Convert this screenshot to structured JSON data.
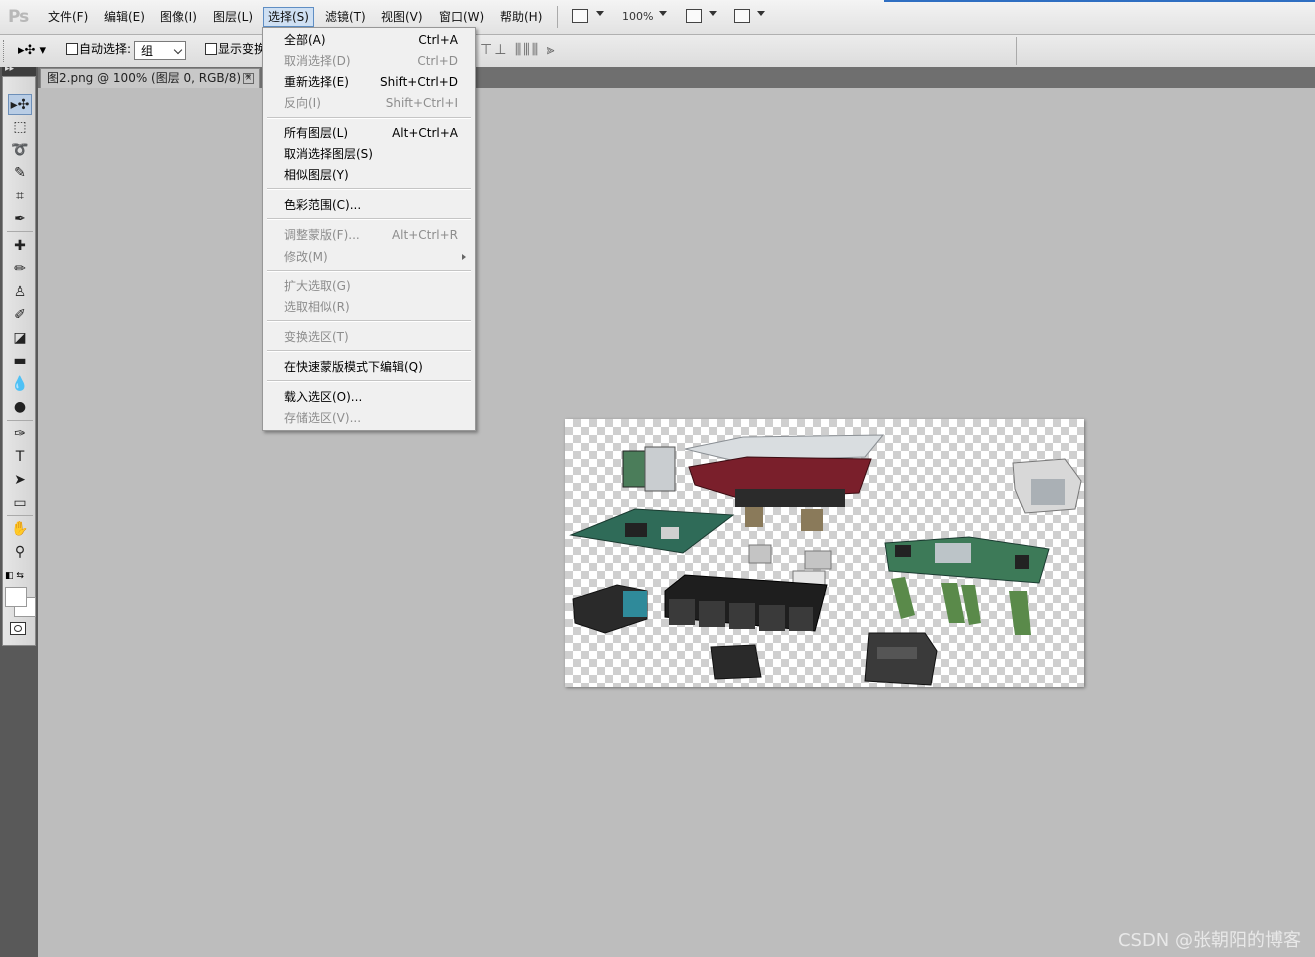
{
  "app": {
    "logo": "Ps"
  },
  "menubar": {
    "items": [
      "文件(F)",
      "编辑(E)",
      "图像(I)",
      "图层(L)",
      "选择(S)",
      "滤镜(T)",
      "视图(V)",
      "窗口(W)",
      "帮助(H)"
    ],
    "active": "选择(S)",
    "zoom": "100%"
  },
  "options": {
    "auto_select_label": "自动选择:",
    "auto_select_value": "组",
    "show_transform_label": "显示变换"
  },
  "document": {
    "tab_title": "图2.png @ 100% (图层 0, RGB/8) *",
    "close": "×"
  },
  "select_menu": {
    "items": [
      {
        "label": "全部(A)",
        "shortcut": "Ctrl+A",
        "enabled": true
      },
      {
        "label": "取消选择(D)",
        "shortcut": "Ctrl+D",
        "enabled": false
      },
      {
        "label": "重新选择(E)",
        "shortcut": "Shift+Ctrl+D",
        "enabled": true
      },
      {
        "label": "反向(I)",
        "shortcut": "Shift+Ctrl+I",
        "enabled": false
      },
      {
        "label": "所有图层(L)",
        "shortcut": "Alt+Ctrl+A",
        "enabled": true
      },
      {
        "label": "取消选择图层(S)",
        "shortcut": "",
        "enabled": true
      },
      {
        "label": "相似图层(Y)",
        "shortcut": "",
        "enabled": true
      },
      {
        "label": "色彩范围(C)...",
        "shortcut": "",
        "enabled": true
      },
      {
        "label": "调整蒙版(F)...",
        "shortcut": "Alt+Ctrl+R",
        "enabled": false
      },
      {
        "label": "修改(M)",
        "shortcut": "",
        "enabled": false,
        "submenu": true
      },
      {
        "label": "扩大选取(G)",
        "shortcut": "",
        "enabled": false
      },
      {
        "label": "选取相似(R)",
        "shortcut": "",
        "enabled": false
      },
      {
        "label": "变换选区(T)",
        "shortcut": "",
        "enabled": false
      },
      {
        "label": "在快速蒙版模式下编辑(Q)",
        "shortcut": "",
        "enabled": true
      },
      {
        "label": "载入选区(O)...",
        "shortcut": "",
        "enabled": true
      },
      {
        "label": "存储选区(V)...",
        "shortcut": "",
        "enabled": false
      }
    ]
  },
  "tools": [
    "move-tool-icon",
    "marquee-tool-icon",
    "lasso-tool-icon",
    "quick-selection-tool-icon",
    "crop-tool-icon",
    "eyedropper-tool-icon",
    "healing-brush-tool-icon",
    "brush-tool-icon",
    "clone-stamp-tool-icon",
    "history-brush-tool-icon",
    "eraser-tool-icon",
    "gradient-tool-icon",
    "blur-tool-icon",
    "dodge-tool-icon",
    "pen-tool-icon",
    "type-tool-icon",
    "path-selection-tool-icon",
    "rectangle-tool-icon",
    "hand-tool-icon",
    "zoom-tool-icon"
  ],
  "colors": {
    "foreground": "#ffffff",
    "background": "#ffffff",
    "workspace": "#bdbdbd",
    "menu_highlight": "#cfe0f3"
  },
  "watermark": "CSDN @张朝阳的博客"
}
